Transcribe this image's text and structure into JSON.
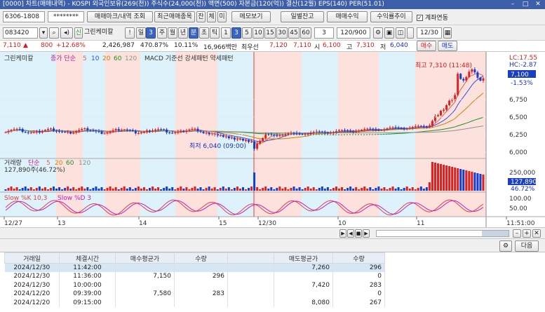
{
  "titlebar": {
    "title": "[0000] 차트(매매내역) - KOSPI 외국인보유(269(천)) 주식수(24,000(천)) 액면(500) 자본금(120(억)) 결산(12월) EPS(140) PER(51.01)"
  },
  "toolbar": {
    "account": "6306-1808",
    "password": "********",
    "btn_lookup": "매매마크/내역 조회",
    "btn_recent": "최근매매종목",
    "jan": "잔",
    "che": "체",
    "mi": "미",
    "btn_memo": "메모보기",
    "btn_daily": "일별잔고",
    "btn_profit": "매매수익",
    "btn_profit_chart": "수익률추이",
    "chk_link": "계좌연동"
  },
  "toolbar2": {
    "code": "083420",
    "name": "그린케미칼",
    "excl": "!",
    "il": "일",
    "il_num": "3",
    "ju": "주",
    "wol": "월",
    "nyeon": "년",
    "bun": "분",
    "cho": "초",
    "tick": "틱",
    "n1": "1",
    "n3": "3",
    "n5": "5",
    "n10": "10",
    "n15": "15",
    "n30": "30",
    "n45": "45",
    "n60": "60",
    "period": "3",
    "count": "120/900",
    "date": "12/30"
  },
  "pricebar": {
    "price": "7,110",
    "arrow": "▲",
    "change": "800",
    "rate": "+12.68%",
    "volume": "2,426,987",
    "volrate": "470.87%",
    "turnover": "10.11%",
    "amount": "16,966백만",
    "low_label": "최우선",
    "bid": "7,120",
    "ask": "7,110",
    "open_l": "시",
    "open": "6,100",
    "high_l": "고",
    "high": "7,310",
    "low_l": "저",
    "low": "6,040",
    "buy": "매수",
    "sell": "매도"
  },
  "chart_data": {
    "type": "candlestick",
    "title": "그린케미칼",
    "legend": {
      "price": "그린케미칼",
      "ma_label": "종가 단순",
      "ma": [
        "5",
        "10",
        "20",
        "60",
        "120"
      ],
      "macd": "MACD 기준선 강세패턴 약세패턴"
    },
    "annotations": {
      "high": "최고 7,310 (11:48)",
      "low": "최저 6,040 (09:00)",
      "lc": "LC:17.55",
      "hc": "HC:-2.87",
      "cur": "7,100",
      "pct": "-1.53%"
    },
    "price_axis": [
      "6,750",
      "6,500",
      "6,250",
      "6,000"
    ],
    "volume_panel": {
      "title": "거래량",
      "ma_label": "단순",
      "ma": [
        "5",
        "20",
        "60",
        "120"
      ],
      "value": "127,890주(46.72%)",
      "axis": [
        "250,000",
        "127,890",
        "46.72%"
      ]
    },
    "stoch_panel": {
      "k": "Slow %K 10,3",
      "d": "Slow %D 3",
      "axis": [
        "100.00",
        "50.00"
      ]
    },
    "x_labels": [
      "12/27",
      "13",
      "14",
      "15",
      "12/30",
      "10",
      "11",
      "11:51:00"
    ],
    "ylim": [
      5950,
      7350
    ]
  },
  "grid": {
    "headers": [
      "거래일",
      "체결시간",
      "매수평균가",
      "수량",
      "",
      "매도평균가",
      "수량"
    ],
    "rows": [
      [
        "2024/12/30",
        "11:42:00",
        "",
        "",
        "",
        "7,260",
        "296"
      ],
      [
        "2024/12/30",
        "11:36:00",
        "7,150",
        "296",
        "",
        "",
        "0"
      ],
      [
        "2024/12/30",
        "10:00:00",
        "",
        "",
        "",
        "7,420",
        "283"
      ],
      [
        "2024/12/20",
        "09:39:00",
        "7,580",
        "283",
        "",
        "",
        "0"
      ],
      [
        "2024/12/20",
        "09:15:00",
        "",
        "",
        "",
        "8,080",
        "267"
      ]
    ],
    "next": "다음"
  }
}
